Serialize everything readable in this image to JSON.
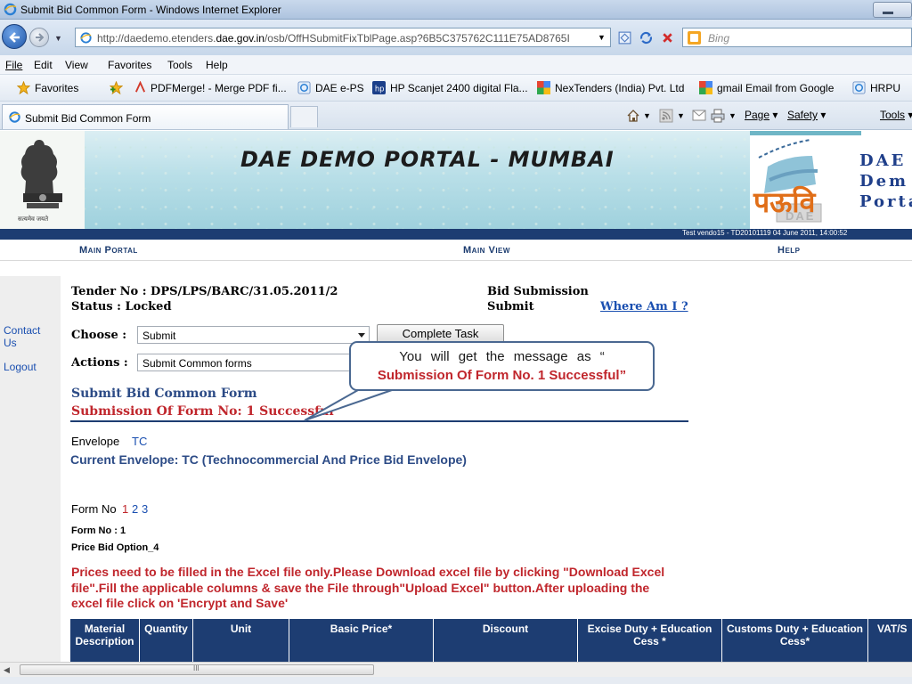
{
  "window": {
    "title": "Submit Bid Common Form - Windows Internet Explorer"
  },
  "address_bar": {
    "url_prefix": "http://daedemo.etenders.",
    "url_domain": "dae.gov.in",
    "url_suffix": "/osb/OffHSubmitFixTblPage.asp?6B5C375762C111E75AD8765I",
    "search_placeholder": "Bing"
  },
  "menu": {
    "items": [
      "File",
      "Edit",
      "View",
      "Favorites",
      "Tools",
      "Help"
    ]
  },
  "favorites_bar": {
    "label": "Favorites",
    "items": [
      "PDFMerge! - Merge PDF fi...",
      "DAE e-PS",
      "HP Scanjet 2400 digital Fla...",
      "NexTenders (India) Pvt. Ltd",
      "gmail Email from Google",
      "HRPU"
    ]
  },
  "tabs": {
    "active_label": "Submit Bid Common Form"
  },
  "command_bar": {
    "page_label": "Page",
    "safety_label": "Safety",
    "tools_label": "Tools"
  },
  "banner": {
    "title": "DAE DEMO PORTAL - MUMBAI",
    "logo_line1": "DAE",
    "logo_line2": "Dem",
    "logo_line3": "Porta",
    "emblem_caption": "सत्यमेव जयते",
    "logo_hindi": "पऊवि",
    "logo_sub": "DAE"
  },
  "info_strip": {
    "text": "Test vendo15 - TD20101119     04 June 2011,  14:00:52"
  },
  "top_links": {
    "main_portal": "Main Portal",
    "main_view": "Main View",
    "help": "Help"
  },
  "left_nav": {
    "contact_line1": "Contact",
    "contact_line2": "Us",
    "logout": "Logout"
  },
  "tender": {
    "tender_no": "Tender No : DPS/LPS/BARC/31.05.2011/2",
    "status": "Status : Locked",
    "bid_submission": "Bid Submission",
    "submit": "Submit",
    "where_am_i": "Where Am I ?"
  },
  "controls": {
    "choose_label": "Choose :",
    "choose_value": "Submit",
    "complete_task": "Complete Task",
    "actions_label": "Actions :",
    "actions_value": "Submit Common forms"
  },
  "form": {
    "heading": "Submit Bid Common Form",
    "success": "Submission Of Form No: 1 Successful",
    "envelope_label": "Envelope",
    "envelope_value": "TC",
    "current_envelope": "Current Envelope: TC (Technocommercial And Price Bid Envelope)",
    "form_no_label": "Form No",
    "form_links": [
      "1",
      "2",
      "3"
    ],
    "form_no_bold": "Form No : 1",
    "price_bid_option": "Price Bid Option_4",
    "instructions": [
      "Prices need to be filled in the Excel file only.Please Download excel file by clicking \"Download Excel",
      "file\".Fill the applicable columns & save the File through\"Upload Excel\" button.After uploading the",
      "excel file click on 'Encrypt and Save'"
    ]
  },
  "callout": {
    "line1": "You will get the message as “",
    "line2": "Submission Of Form No. 1 Successful”"
  },
  "table": {
    "headers": [
      "Material Description",
      "Quantity",
      "Unit",
      "Basic Price*",
      "Discount",
      "Excise Duty + Education Cess *",
      "Customs Duty + Education Cess*",
      "VAT/S"
    ]
  },
  "scrollbar": {
    "grip": "III"
  },
  "colors": {
    "navy": "#1d3d72",
    "red_text": "#c0262c",
    "link_blue": "#1a4fb0",
    "banner_teal": "#9fd1dd"
  }
}
